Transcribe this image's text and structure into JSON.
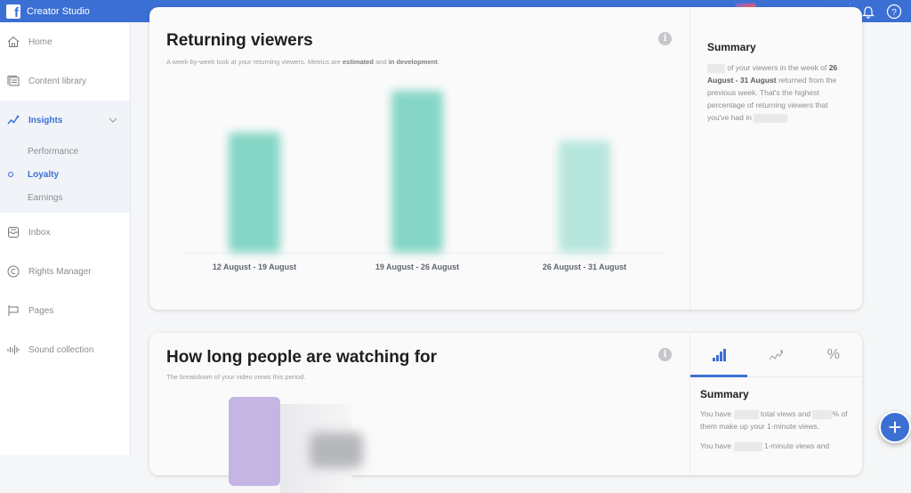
{
  "app": {
    "title": "Creator Studio"
  },
  "topbar": {
    "account_name": "(blurred)",
    "icons": [
      "bell-icon",
      "help-icon"
    ]
  },
  "sidebar": {
    "items": [
      {
        "label": "Home",
        "icon": "home-icon"
      },
      {
        "label": "Content library",
        "icon": "content-library-icon"
      },
      {
        "label": "Insights",
        "icon": "insights-icon",
        "expanded": true,
        "children": [
          {
            "label": "Performance"
          },
          {
            "label": "Loyalty",
            "active": true
          },
          {
            "label": "Earnings"
          }
        ]
      },
      {
        "label": "Inbox",
        "icon": "inbox-icon"
      },
      {
        "label": "Rights Manager",
        "icon": "copyright-icon"
      },
      {
        "label": "Pages",
        "icon": "flag-icon"
      },
      {
        "label": "Sound collection",
        "icon": "sound-icon"
      }
    ]
  },
  "returning": {
    "title": "Returning viewers",
    "subtitle_pre": "A week-by-week look at your returning viewers. Metrics are ",
    "subtitle_b1": "estimated",
    "subtitle_mid": " and ",
    "subtitle_b2": "in development",
    "subtitle_post": ".",
    "summary": {
      "title": "Summary",
      "t1": " of your viewers in the week of ",
      "b1": "26 August - 31 August",
      "t2": " returned from the previous week. That's the highest percentage of returning viewers that you've had in "
    }
  },
  "chart_data": {
    "type": "bar",
    "title": "Returning viewers",
    "categories": [
      "12 August - 19 August",
      "19 August - 26 August",
      "26 August - 31 August"
    ],
    "values": [
      74,
      100,
      69
    ],
    "value_unit": "relative % of tallest bar (actual values blurred)",
    "colors": [
      "#86d6c6",
      "#86d6c6",
      "#b7e6dd"
    ],
    "xlabel": "",
    "ylabel": "",
    "ylim": [
      0,
      100
    ],
    "grid": false
  },
  "watching": {
    "title": "How long people are watching for",
    "subtitle": "The breakdown of your video views this period.",
    "tabs": [
      {
        "icon": "bar-chart-icon",
        "active": true
      },
      {
        "icon": "line-chart-icon"
      },
      {
        "icon": "percent-icon"
      }
    ],
    "summary": {
      "title": "Summary",
      "l1a": "You have ",
      "l1b": " total views and ",
      "l1c": "% of them make up your 1-minute views.",
      "l2a": "You have ",
      "l2b": " 1-minute views and"
    },
    "bar_colors": [
      "#c5b5e3",
      "#e6e7ea"
    ]
  },
  "fab": {
    "label": "+"
  }
}
